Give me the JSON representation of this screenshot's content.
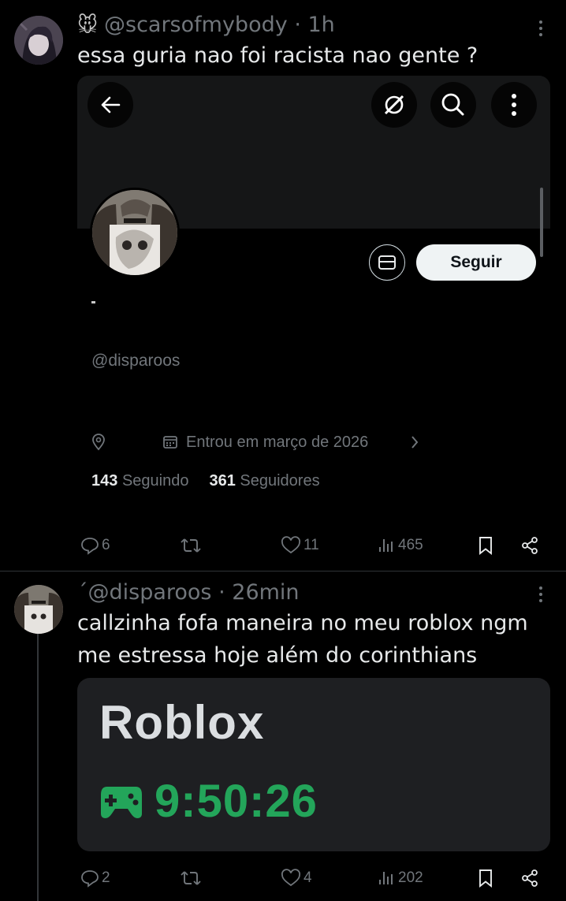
{
  "tweet1": {
    "username": "@scarsofmybody",
    "time": "· 1h",
    "emoji": "🐭",
    "text": "essa guria nao foi racista nao gente ?",
    "embed": {
      "follow_label": "Seguir",
      "handle": "@disparoos",
      "joined": "Entrou em março de 2026",
      "following_count": "143",
      "following_label": "Seguindo",
      "followers_count": "361",
      "followers_label": "Seguidores"
    },
    "actions": {
      "replies": "6",
      "reposts": "",
      "likes": "11",
      "views": "465"
    }
  },
  "tweet2": {
    "prefix_mark": "ˊ",
    "username": "@disparoos",
    "time": "· 26min",
    "text": "callzinha fofa maneira no meu roblox ngm me estressa hoje além do corinthians",
    "image": {
      "title": "Roblox",
      "timer": "9:50:26"
    },
    "actions": {
      "replies": "2",
      "reposts": "",
      "likes": "4",
      "views": "202"
    }
  },
  "colors": {
    "background": "#000000",
    "text": "#e7e9ea",
    "muted": "#71767b",
    "divider": "#2f3336",
    "timer_green": "#23a55a"
  },
  "icons": [
    "reply-icon",
    "repost-icon",
    "like-icon",
    "views-icon",
    "bookmark-icon",
    "share-icon",
    "more-icon",
    "back-arrow-icon",
    "grok-icon",
    "search-icon",
    "message-icon",
    "location-icon",
    "calendar-icon",
    "chevron-right-icon",
    "gamepad-icon"
  ]
}
